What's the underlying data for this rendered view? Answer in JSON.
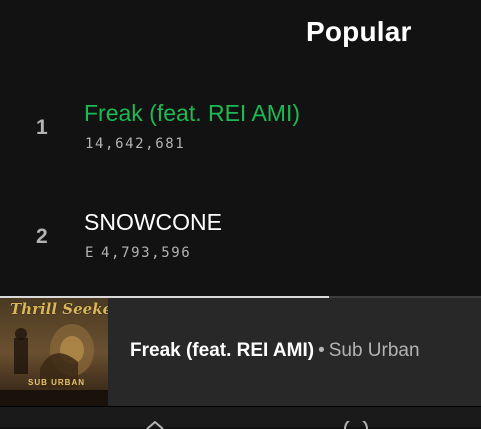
{
  "popular": {
    "heading": "Popular",
    "tracks": [
      {
        "index": "1",
        "title": "Freak (feat. REI AMI)",
        "explicit": "",
        "plays": "14,642,681",
        "playing": true
      },
      {
        "index": "2",
        "title": "SNOWCONE",
        "explicit": "E",
        "plays": "4,793,596",
        "playing": false
      }
    ]
  },
  "now_playing": {
    "title": "Freak (feat. REI AMI)",
    "separator": "•",
    "artist": "Sub Urban",
    "progress": 0.685,
    "cover": {
      "title": "Thrill Seeker",
      "artist": "SUB URBAN"
    }
  },
  "bottom_nav": {
    "icons": [
      "home-icon",
      "search-icon"
    ]
  },
  "colors": {
    "background": "#121212",
    "accent_green": "#1db954",
    "miniplayer": "#282828",
    "secondary_text": "#b3b3b3"
  }
}
